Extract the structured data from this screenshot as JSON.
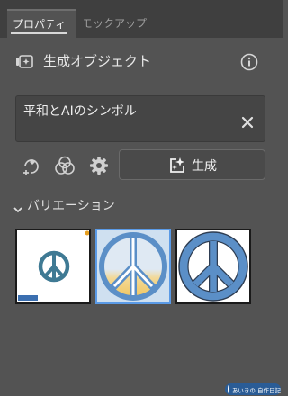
{
  "tabs": [
    {
      "label": "プロパティ",
      "active": true
    },
    {
      "label": "モックアップ",
      "active": false
    }
  ],
  "panel": {
    "title": "生成オブジェクト",
    "title_icon": "generative-object-icon",
    "info_icon": "info-icon"
  },
  "prompt": {
    "value": "平和とAIのシンボル",
    "clear_icon": "close-icon"
  },
  "tools": [
    {
      "icon": "reference-style-icon"
    },
    {
      "icon": "color-circles-icon"
    },
    {
      "icon": "gear-icon"
    }
  ],
  "generate_button": {
    "label": "生成",
    "icon": "generate-sparkle-icon"
  },
  "variations": {
    "label": "バリエーション",
    "chevron_icon": "chevron-down-icon",
    "items": [
      {
        "name": "peace-sign-simple-blue",
        "selected": false
      },
      {
        "name": "peace-sign-gradient-yellow",
        "selected": true
      },
      {
        "name": "peace-sign-blue-outline",
        "selected": false
      }
    ]
  },
  "colors": {
    "panel_bg": "#535353",
    "tabbar_bg": "#3f3f3f",
    "selection": "#5a9ae6",
    "peace_blue": "#5b8fc7",
    "peace_teal": "#3f7a94"
  },
  "watermark": {
    "text": "あいきの 自作日記"
  }
}
